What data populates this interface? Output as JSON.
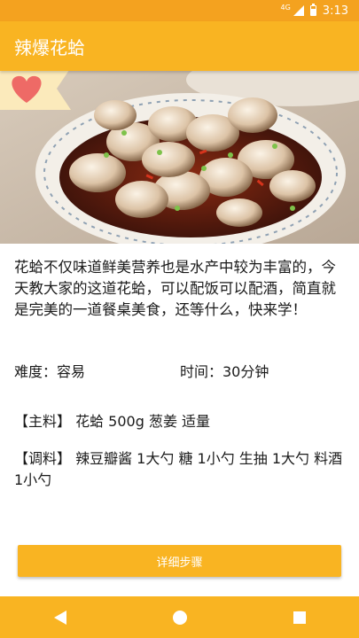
{
  "status_bar": {
    "network": "4G",
    "time": "3:13"
  },
  "app_bar": {
    "title": "辣爆花蛤"
  },
  "recipe": {
    "description": "花蛤不仅味道鲜美营养也是水产中较为丰富的，今天教大家的这道花蛤，可以配饭可以配酒，简直就是完美的一道餐桌美食，还等什么，快来学！",
    "difficulty": "难度：容易",
    "time": "时间：30分钟",
    "main_ingredients": "【主料】 花蛤 500g  葱姜 适量",
    "seasonings": "【调料】 辣豆瓣酱 1大勺  糖 1小勺 生抽 1大勺  料酒 1小勺"
  },
  "actions": {
    "steps_button_label": "详细步骤"
  },
  "nav_bar": {
    "back_icon": "back-triangle-icon",
    "home_icon": "home-circle-icon",
    "recents_icon": "recents-square-icon"
  },
  "colors": {
    "status_bar": "#f4a21f",
    "primary": "#f9b422",
    "heart": "#ee6a66",
    "ribbon": "#fbeabb"
  }
}
